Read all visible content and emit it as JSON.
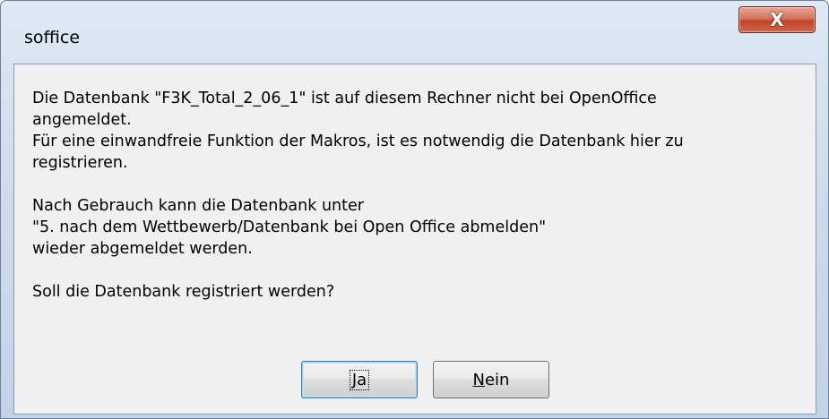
{
  "window": {
    "title": "soffice",
    "close_glyph": "X",
    "close_icon": "close-icon"
  },
  "message": {
    "lines": [
      "Die Datenbank \"F3K_Total_2_06_1\" ist auf diesem Rechner nicht bei OpenOffice",
      "angemeldet.",
      "Für eine einwandfreie Funktion der Makros, ist es notwendig die Datenbank hier zu",
      "registrieren.",
      "",
      "Nach Gebrauch kann die Datenbank unter",
      "\"5. nach dem Wettbewerb/Datenbank bei Open Office abmelden\"",
      "wieder abgemeldet werden.",
      "",
      "Soll die Datenbank registriert werden?"
    ]
  },
  "buttons": {
    "yes": {
      "mnemonic": "J",
      "rest": "a"
    },
    "no": {
      "mnemonic": "N",
      "rest": "ein"
    }
  },
  "colors": {
    "close_button": "#c0442a",
    "client_bg": "#f0f0f0",
    "default_button_border": "#3c7fb1"
  }
}
